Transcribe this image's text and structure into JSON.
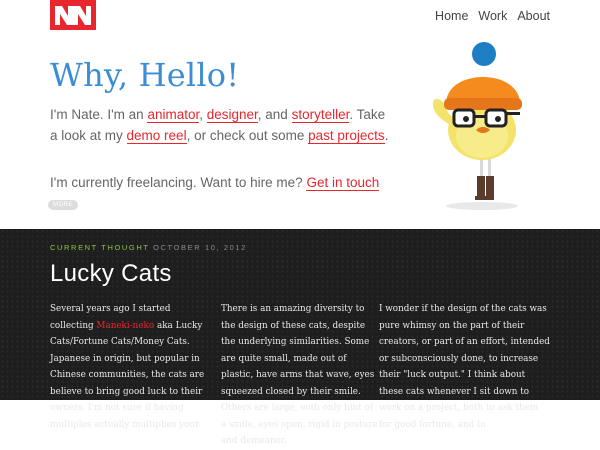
{
  "nav": {
    "items": [
      "Home",
      "Work",
      "About"
    ]
  },
  "hero": {
    "title": "Why, Hello!",
    "line1_a": "I'm Nate. I'm an ",
    "animator": "animator",
    "comma": ", ",
    "designer": "designer",
    "and": ", and ",
    "storyteller": "storyteller",
    "line2_a": ". Take a look at my ",
    "demo_reel": "demo reel",
    "line2_b": ", or check out some ",
    "past_projects": "past projects",
    "period": ".",
    "freelance_text": "I'm currently freelancing. Want to hire me? ",
    "get_in_touch": "Get in touch",
    "more_label": "MORE"
  },
  "blog": {
    "thought_label": "CURRENT THOUGHT",
    "date": "OCTOBER 10, 2012",
    "title": "Lucky Cats",
    "col1_a": "Several years ago I started collecting ",
    "col1_link": "Maneki-neko",
    "col1_b": " aka Lucky Cats/Fortune Cats/Money Cats. Japanese in origin, but popular in Chinese communities, the cats are believe to bring good luck to their owners. I'm not sure if having multiples actually multiplies your",
    "col2": "There is an amazing diversity to the design of these cats, despite the underlying similarities. Some are quite small, made out of plastic, have arms that wave, eyes squeezed closed by their smile. Others are large, with only hint of a smile, eyes open, rigid in posture and demeanor.",
    "col3": "I wonder if the design of the cats was pure whimsy on the part of their creators, or part of an effort, intended or subconsciously done, to increase their \"luck output.\" I think about these cats whenever I sit down to work on a project, both to ask them for good fortune, and to"
  },
  "colors": {
    "accent_red": "#e8262d",
    "title_blue": "#3b8ed6",
    "dark_bg": "#1e1e1e",
    "green": "#8ec63f"
  }
}
